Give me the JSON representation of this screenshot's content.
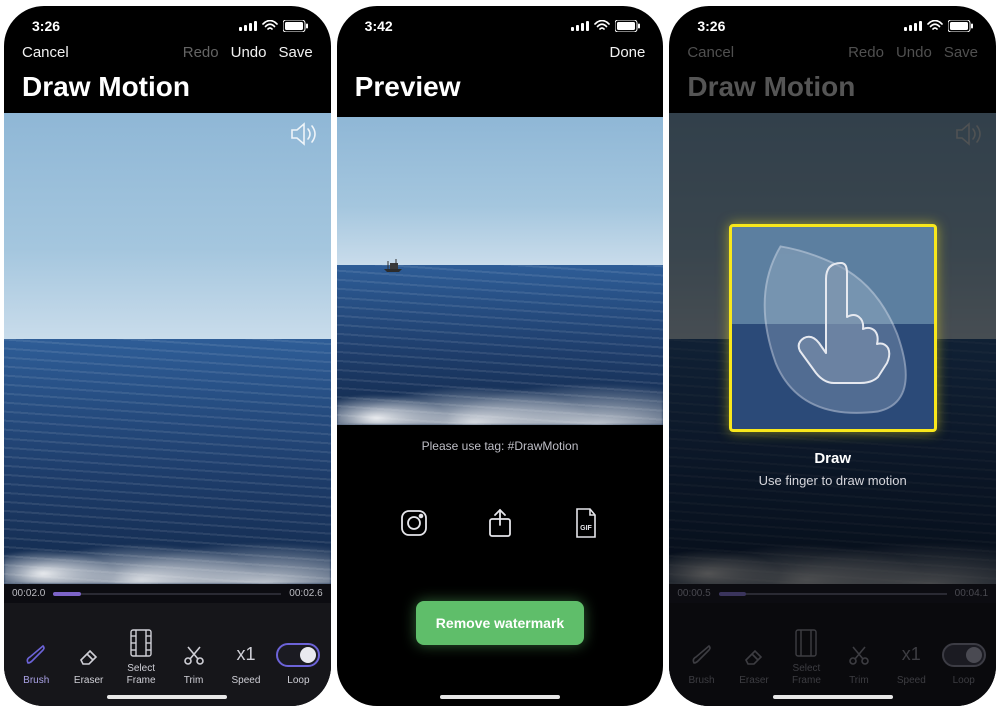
{
  "screens": [
    {
      "status": {
        "time": "3:26"
      },
      "nav": {
        "left": "Cancel",
        "redo": "Redo",
        "undo": "Undo",
        "save": "Save"
      },
      "title": "Draw Motion",
      "time": {
        "start": "00:02.0",
        "end": "00:02.6"
      },
      "tools": {
        "brush": "Brush",
        "eraser": "Eraser",
        "select": "Select\nFrame",
        "trim": "Trim",
        "speed": "Speed",
        "speedVal": "x1",
        "loop": "Loop"
      }
    },
    {
      "status": {
        "time": "3:42"
      },
      "nav": {
        "done": "Done"
      },
      "title": "Preview",
      "caption": "Please use tag: #DrawMotion",
      "share": {
        "instagram": "instagram-icon",
        "system": "share-icon",
        "gif": "gif-icon",
        "gifLabel": "GIF"
      },
      "remove": "Remove watermark"
    },
    {
      "status": {
        "time": "3:26"
      },
      "nav": {
        "left": "Cancel",
        "redo": "Redo",
        "undo": "Undo",
        "save": "Save"
      },
      "title": "Draw Motion",
      "time": {
        "start": "00:00.5",
        "end": "00:04.1"
      },
      "tools": {
        "brush": "Brush",
        "eraser": "Eraser",
        "select": "Select\nFrame",
        "trim": "Trim",
        "speed": "Speed",
        "speedVal": "x1",
        "loop": "Loop"
      },
      "tutorial": {
        "title": "Draw",
        "sub": "Use finger to draw motion"
      }
    }
  ]
}
